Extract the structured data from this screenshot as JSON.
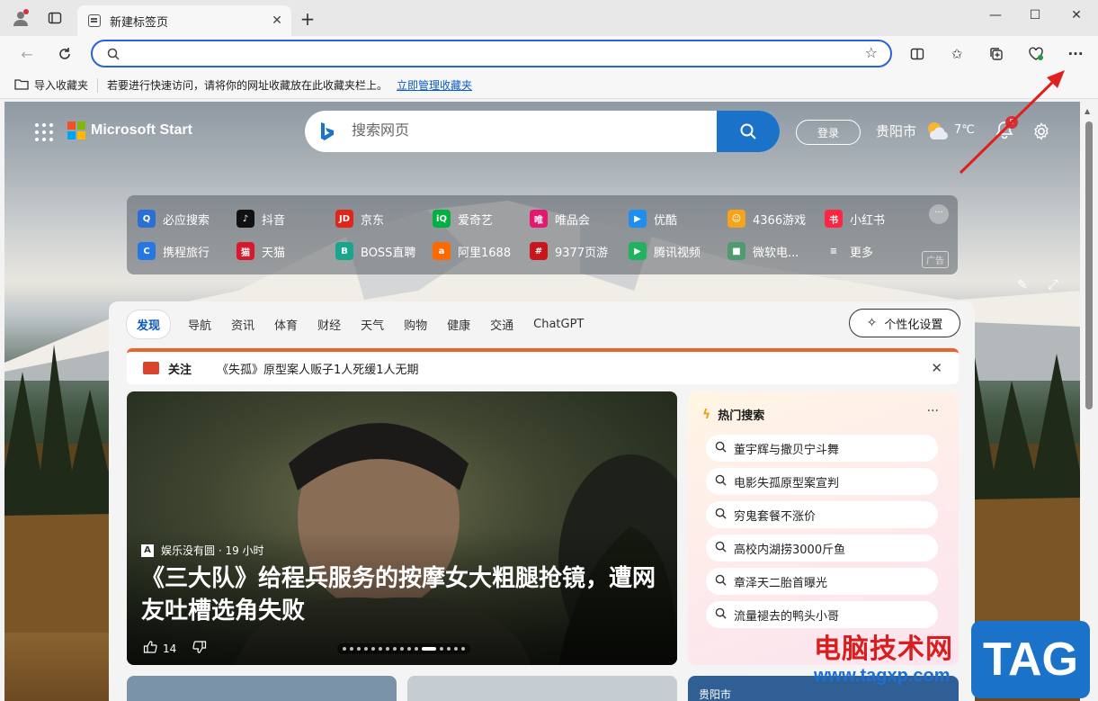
{
  "browser": {
    "tab_title": "新建标签页",
    "address_placeholder": "",
    "favbar": {
      "import_label": "导入收藏夹",
      "hint": "若要进行快速访问，请将你的网址收藏放在此收藏夹栏上。",
      "manage_link": "立即管理收藏夹"
    }
  },
  "header": {
    "brand": "Microsoft Start",
    "search_placeholder": "搜索网页",
    "login": "登录",
    "city": "贵阳市",
    "temperature": "7℃",
    "notification_count": "5"
  },
  "quick_links": {
    "row1": [
      {
        "label": "必应搜索",
        "icon": "bing-search-icon",
        "color": "#2a6fd6",
        "glyph": "Q"
      },
      {
        "label": "抖音",
        "icon": "douyin-icon",
        "color": "#111111",
        "glyph": "♪"
      },
      {
        "label": "京东",
        "icon": "jd-icon",
        "color": "#e1251b",
        "glyph": "JD"
      },
      {
        "label": "爱奇艺",
        "icon": "iqiyi-icon",
        "color": "#00b140",
        "glyph": "iQ"
      },
      {
        "label": "唯品会",
        "icon": "vip-icon",
        "color": "#e5176f",
        "glyph": "唯"
      },
      {
        "label": "优酷",
        "icon": "youku-icon",
        "color": "#1f8ef1",
        "glyph": "▶"
      },
      {
        "label": "4366游戏",
        "icon": "game4366-icon",
        "color": "#f4a51c",
        "glyph": "☺"
      },
      {
        "label": "小红书",
        "icon": "xiaohongshu-icon",
        "color": "#ff2442",
        "glyph": "书"
      }
    ],
    "row2": [
      {
        "label": "携程旅行",
        "icon": "ctrip-icon",
        "color": "#2577e3",
        "glyph": "C"
      },
      {
        "label": "天猫",
        "icon": "tmall-icon",
        "color": "#d8182d",
        "glyph": "猫"
      },
      {
        "label": "BOSS直聘",
        "icon": "boss-icon",
        "color": "#17a58b",
        "glyph": "B"
      },
      {
        "label": "阿里1688",
        "icon": "ali1688-icon",
        "color": "#ff6a00",
        "glyph": "a"
      },
      {
        "label": "9377页游",
        "icon": "game9377-icon",
        "color": "#c8161d",
        "glyph": "#"
      },
      {
        "label": "腾讯视频",
        "icon": "tencent-video-icon",
        "color": "#20b25f",
        "glyph": "▶"
      },
      {
        "label": "微软电...",
        "icon": "ms-store-icon",
        "color": "#4f9a6e",
        "glyph": "■"
      },
      {
        "label": "更多",
        "icon": "more-menu-icon",
        "color": "transparent",
        "glyph": "≡"
      }
    ],
    "ad_label": "广告"
  },
  "feed": {
    "tabs": [
      "发现",
      "导航",
      "资讯",
      "体育",
      "财经",
      "天气",
      "购物",
      "健康",
      "交通",
      "ChatGPT"
    ],
    "personalize": "个性化设置",
    "notice": {
      "label": "关注",
      "text": "《失孤》原型案人贩子1人死缓1人无期"
    },
    "hero": {
      "source": "娱乐没有圆 · 19 小时",
      "headline": "《三大队》给程兵服务的按摩女大粗腿抢镜，遭网友吐槽选角失败",
      "likes": "14"
    },
    "hot_search": {
      "title": "热门搜索",
      "items": [
        "董宇辉与撒贝宁斗舞",
        "电影失孤原型案宣判",
        "穷鬼套餐不涨价",
        "高校内湖捞3000斤鱼",
        "章泽天二胎首曝光",
        "流量褪去的鸭头小哥"
      ]
    },
    "next_card_label": "贵阳市"
  },
  "watermark": {
    "cn": "电脑技术网",
    "url": "www.tagxp.com",
    "tag": "TAG"
  }
}
